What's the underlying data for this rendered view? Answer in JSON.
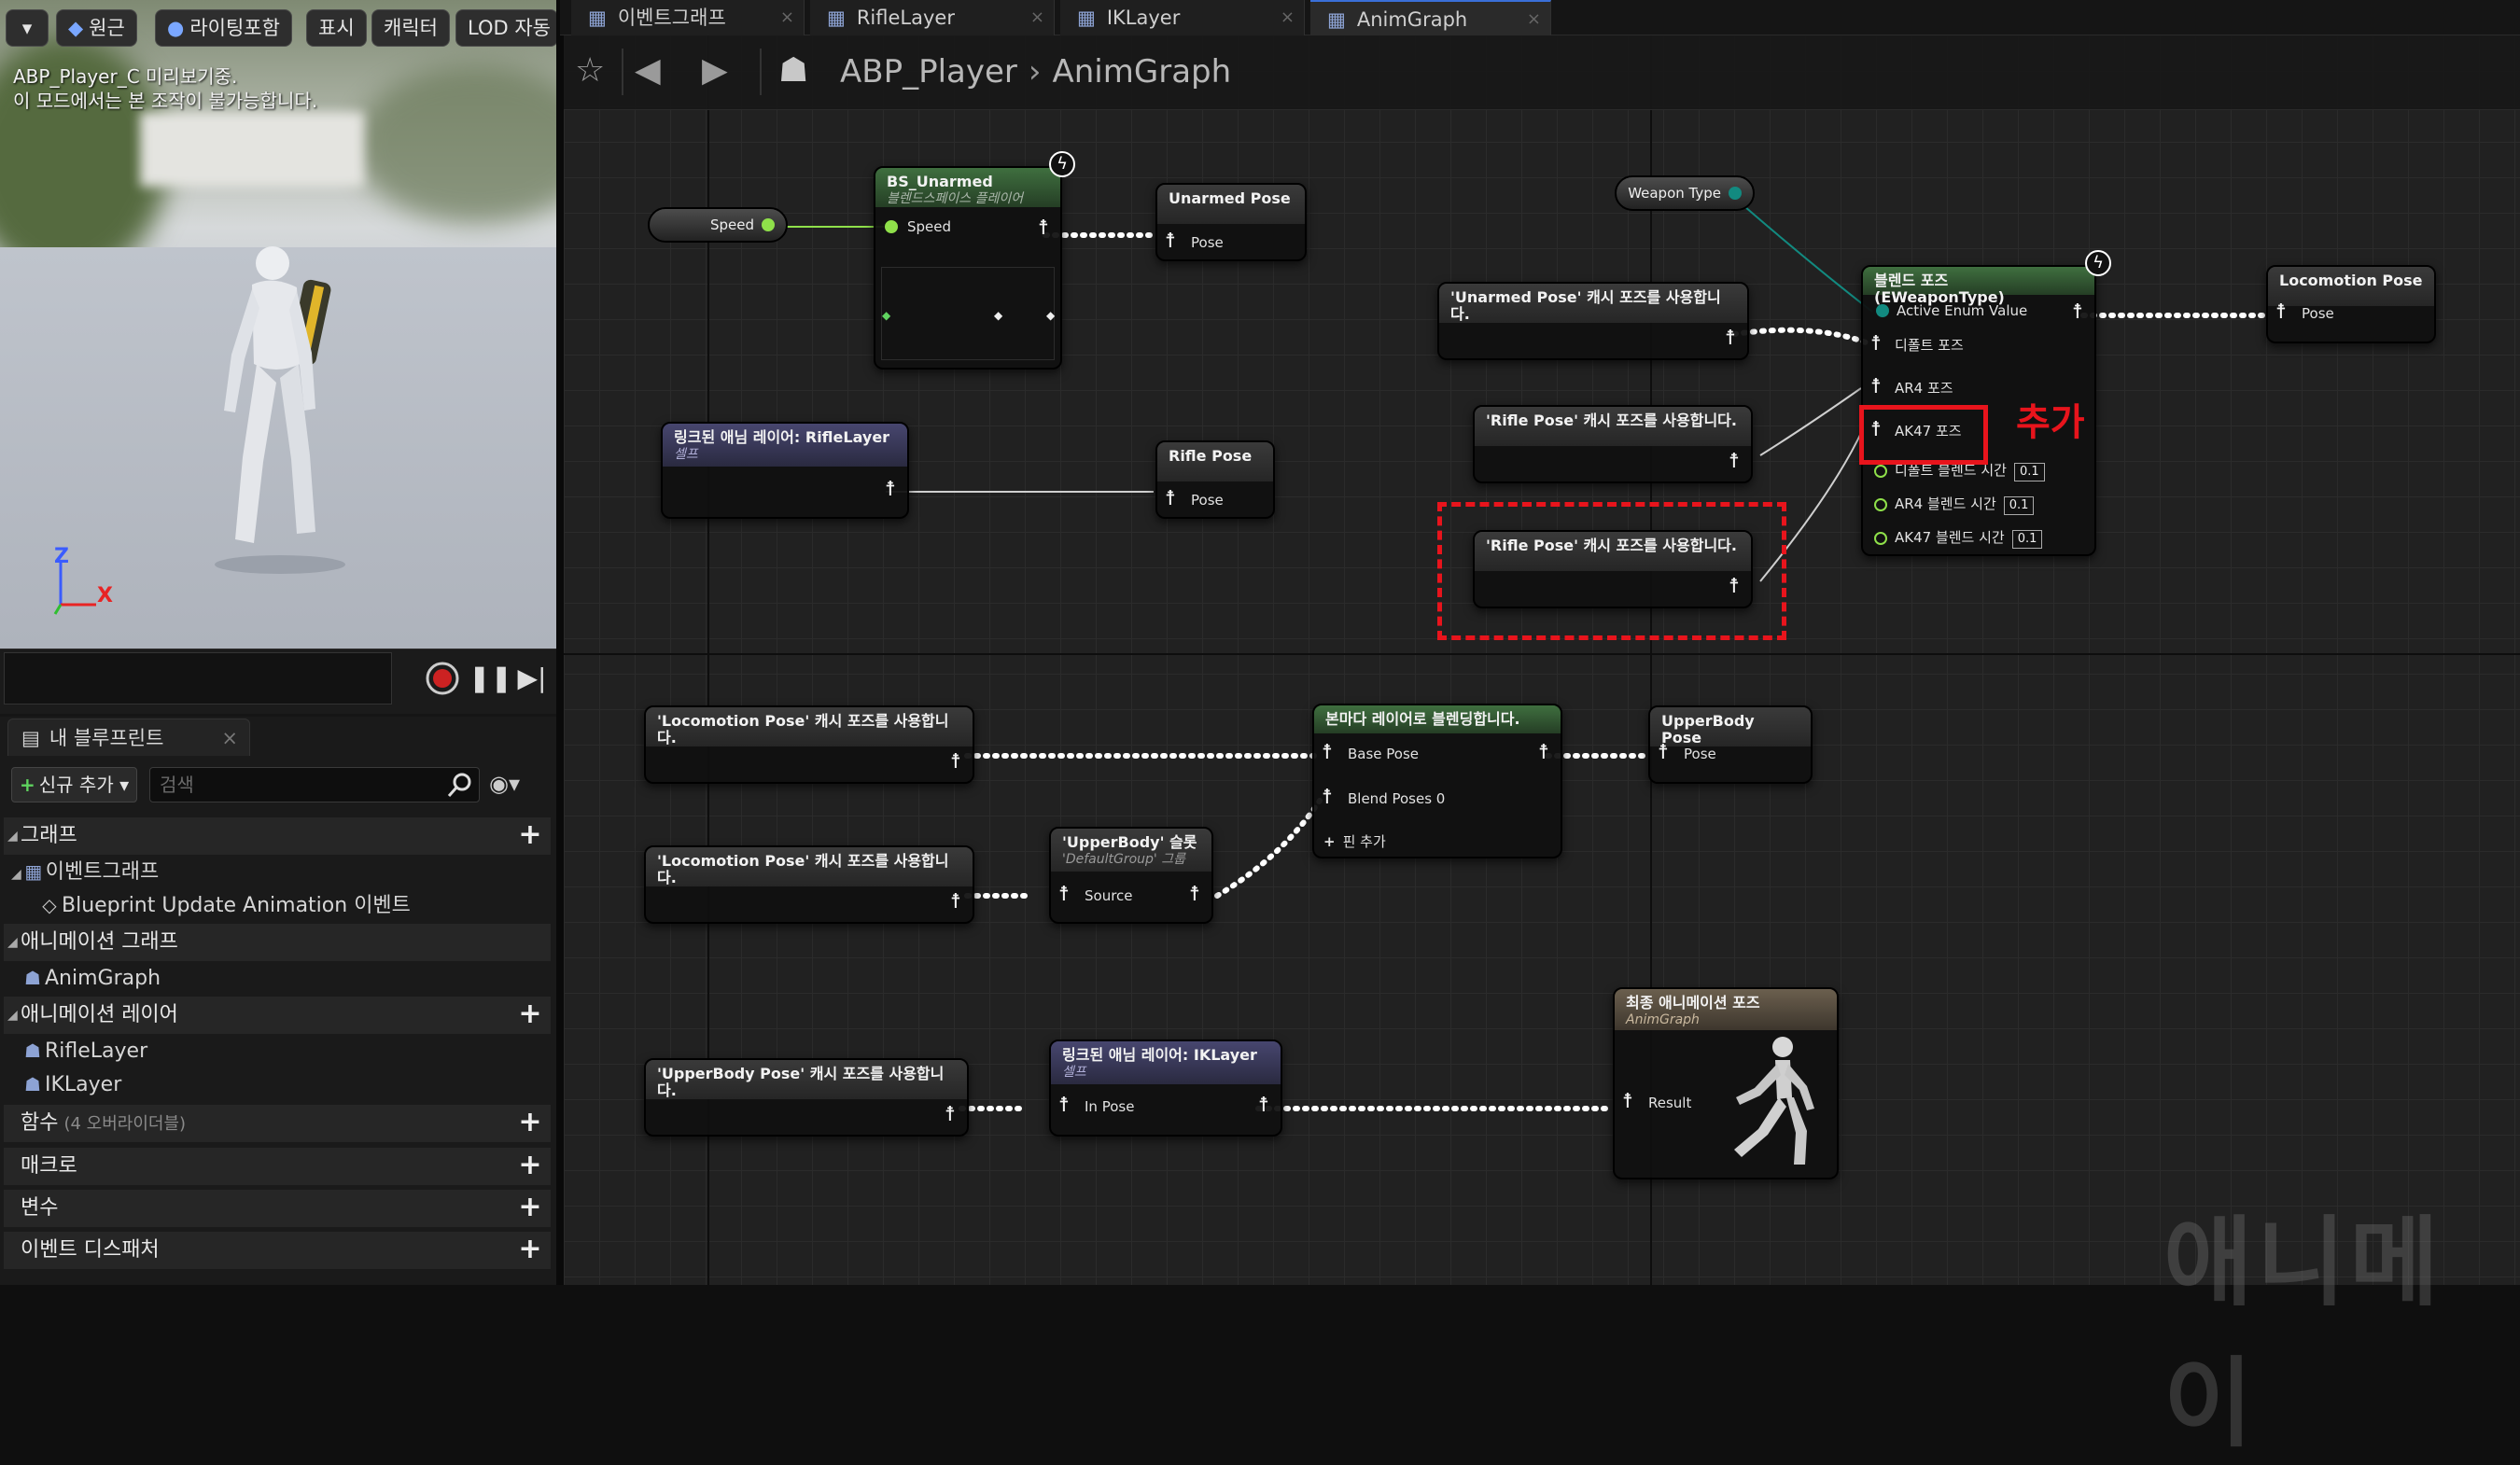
{
  "viewport": {
    "buttons": [
      {
        "label": "원근",
        "icon": "cube-icon"
      },
      {
        "label": "라이팅포함",
        "icon": "sphere-icon"
      },
      {
        "label": "표시"
      },
      {
        "label": "캐릭터"
      },
      {
        "label": "LOD 자동"
      }
    ],
    "info_line1": "ABP_Player_C 미리보기중.",
    "info_line2": "이 모드에서는 본 조작이 불가능합니다.",
    "axis": {
      "z": "Z",
      "x": "X"
    }
  },
  "blueprint_panel": {
    "tab_label": "내 블루프린트",
    "add_new_label": "신규 추가",
    "search_placeholder": "검색",
    "categories": [
      {
        "label": "그래프"
      },
      {
        "label": "애니메이션 그래프"
      },
      {
        "label": "애니메이션 레이어"
      },
      {
        "label": "함수",
        "sub": "(4 오버라이더블)"
      },
      {
        "label": "매크로"
      },
      {
        "label": "변수"
      },
      {
        "label": "이벤트 디스패처"
      }
    ],
    "items": {
      "event_graph": "이벤트그래프",
      "bua_event": "Blueprint Update Animation 이벤트",
      "anim_graph": "AnimGraph",
      "rifle_layer": "RifleLayer",
      "ik_layer": "IKLayer"
    }
  },
  "tabs": [
    {
      "label": "이벤트그래프"
    },
    {
      "label": "RifleLayer"
    },
    {
      "label": "IKLayer"
    },
    {
      "label": "AnimGraph",
      "active": true
    }
  ],
  "breadcrumb": {
    "root": "ABP_Player",
    "current": "AnimGraph"
  },
  "nodes": {
    "speed_var": "Speed",
    "weapon_type_var": "Weapon Type",
    "bs_unarmed": {
      "title": "BS_Unarmed",
      "subtitle": "블렌드스페이스 플레이어",
      "pin": "Speed"
    },
    "unarmed_pose": {
      "title": "Unarmed Pose",
      "pin": "Pose"
    },
    "linked_rifle": {
      "title": "링크된 애님 레이어: RifleLayer",
      "subtitle": "셀프"
    },
    "rifle_pose": {
      "title": "Rifle Pose",
      "pin": "Pose"
    },
    "use_unarmed": "'Unarmed Pose' 캐시 포즈를 사용합니다.",
    "use_rifle1": "'Rifle Pose' 캐시 포즈를 사용합니다.",
    "use_rifle2": "'Rifle Pose' 캐시 포즈를 사용합니다.",
    "blend_poses": {
      "title": "블렌드 포즈 (EWeaponType)",
      "active_enum": "Active Enum Value",
      "default_pose": "디폴트 포즈",
      "ar4_pose": "AR4 포즈",
      "ak47_pose": "AK47 포즈",
      "default_blend": "디폴트 블렌드 시간",
      "ar4_blend": "AR4 블렌드 시간",
      "ak47_blend": "AK47 블렌드 시간",
      "blend_value": "0.1"
    },
    "annotation_add": "추가",
    "locomotion_pose": {
      "title": "Locomotion Pose",
      "pin": "Pose"
    },
    "use_locomotion1": "'Locomotion Pose' 캐시 포즈를 사용합니다.",
    "use_locomotion2": "'Locomotion Pose' 캐시 포즈를 사용합니다.",
    "upperbody_slot": {
      "title": "'UpperBody' 슬롯",
      "subtitle": "'DefaultGroup' 그룹",
      "pin": "Source"
    },
    "layered_blend": {
      "title": "본마다 레이어로 블렌딩합니다.",
      "base": "Base Pose",
      "blend": "Blend Poses 0",
      "add_pin": "핀 추가"
    },
    "upperbody_pose": {
      "title": "UpperBody Pose",
      "pin": "Pose"
    },
    "use_upperbody": "'UpperBody Pose' 캐시 포즈를 사용합니다.",
    "linked_ik": {
      "title": "링크된 애님 레이어: IKLayer",
      "subtitle": "셀프",
      "pin": "In Pose"
    },
    "final_pose": {
      "title": "최종 애니메이션 포즈",
      "subtitle": "AnimGraph",
      "pin": "Result"
    }
  },
  "watermark": "애니메이",
  "colors": {
    "accent_red": "#e8141c",
    "exec_white": "#ffffff",
    "float_green": "#8fe04a",
    "enum_teal": "#128a80"
  }
}
